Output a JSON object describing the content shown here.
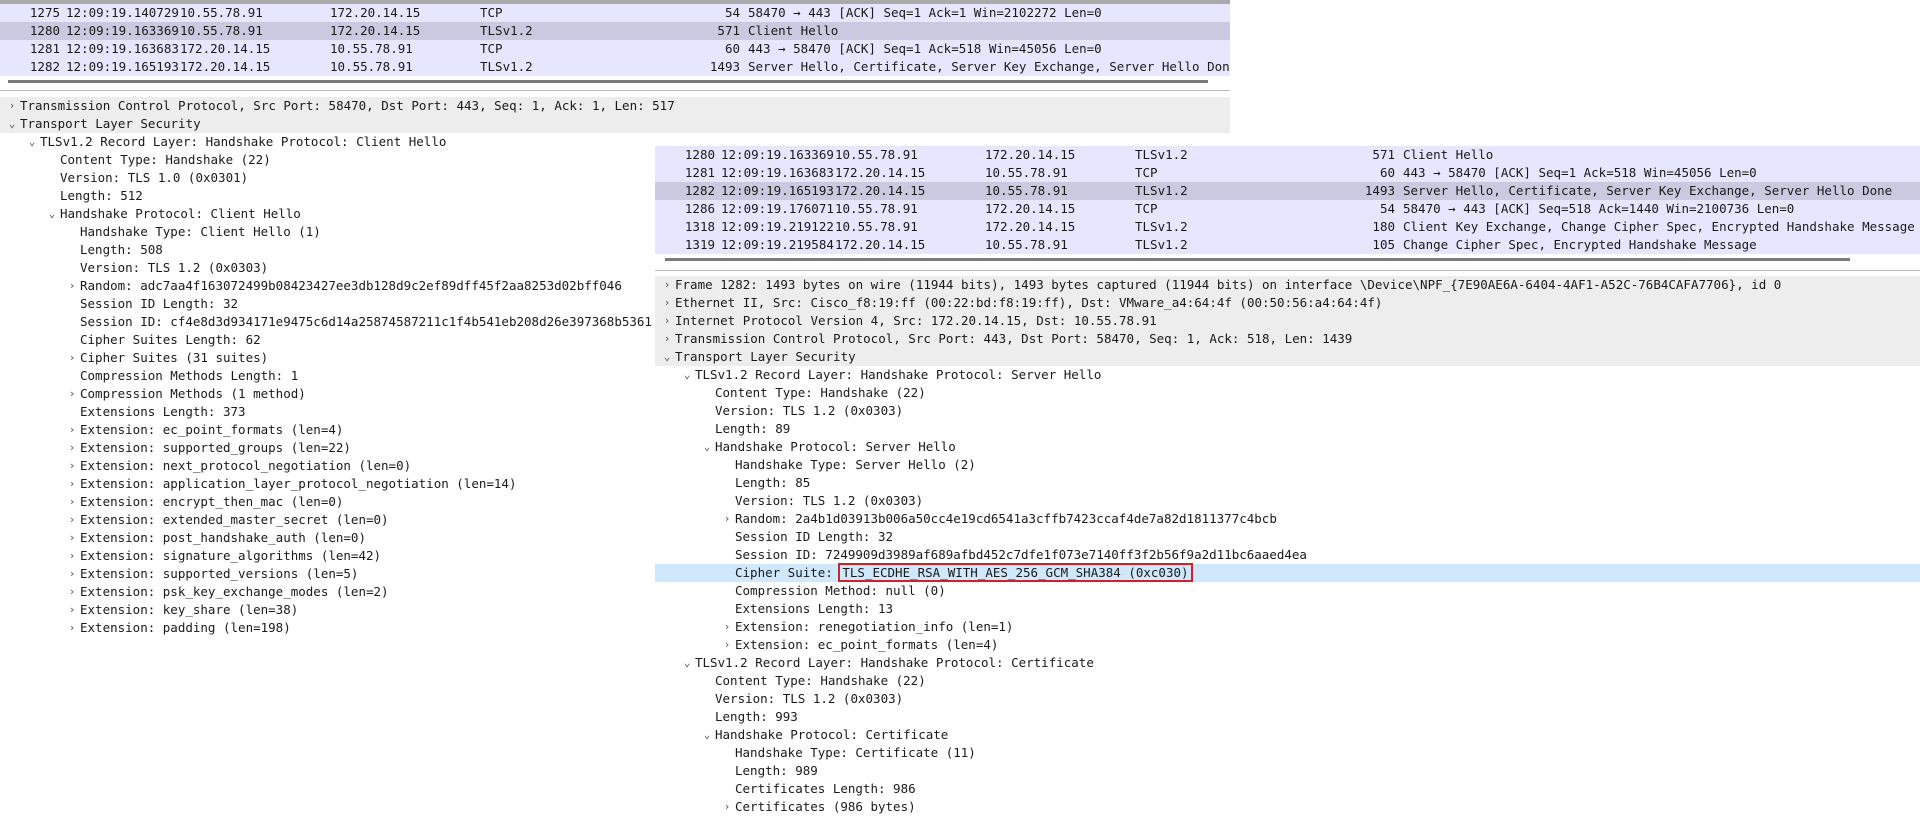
{
  "left_packets": [
    {
      "no": "1275",
      "time": "12:09:19.140729",
      "src": "10.55.78.91",
      "dst": "172.20.14.15",
      "proto": "TCP",
      "len": "54",
      "info": "58470 → 443 [ACK] Seq=1 Ack=1 Win=2102272 Len=0",
      "style": "norm"
    },
    {
      "no": "1280",
      "time": "12:09:19.163369",
      "src": "10.55.78.91",
      "dst": "172.20.14.15",
      "proto": "TLSv1.2",
      "len": "571",
      "info": "Client Hello",
      "style": "selected"
    },
    {
      "no": "1281",
      "time": "12:09:19.163683",
      "src": "172.20.14.15",
      "dst": "10.55.78.91",
      "proto": "TCP",
      "len": "60",
      "info": "443 → 58470 [ACK] Seq=1 Ack=518 Win=45056 Len=0",
      "style": "norm"
    },
    {
      "no": "1282",
      "time": "12:09:19.165193",
      "src": "172.20.14.15",
      "dst": "10.55.78.91",
      "proto": "TLSv1.2",
      "len": "1493",
      "info": "Server Hello, Certificate, Server Key Exchange, Server Hello Done",
      "style": "norm"
    }
  ],
  "left_tree": [
    {
      "indent": 0,
      "toggle": "closed",
      "text": "Transmission Control Protocol, Src Port: 58470, Dst Port: 443, Seq: 1, Ack: 1, Len: 517",
      "shade": true
    },
    {
      "indent": 0,
      "toggle": "open",
      "text": "Transport Layer Security",
      "shade": true
    },
    {
      "indent": 1,
      "toggle": "open",
      "text": "TLSv1.2 Record Layer: Handshake Protocol: Client Hello"
    },
    {
      "indent": 2,
      "toggle": "",
      "text": "Content Type: Handshake (22)"
    },
    {
      "indent": 2,
      "toggle": "",
      "text": "Version: TLS 1.0 (0x0301)"
    },
    {
      "indent": 2,
      "toggle": "",
      "text": "Length: 512"
    },
    {
      "indent": 2,
      "toggle": "open",
      "text": "Handshake Protocol: Client Hello"
    },
    {
      "indent": 3,
      "toggle": "",
      "text": "Handshake Type: Client Hello (1)"
    },
    {
      "indent": 3,
      "toggle": "",
      "text": "Length: 508"
    },
    {
      "indent": 3,
      "toggle": "",
      "text": "Version: TLS 1.2 (0x0303)"
    },
    {
      "indent": 3,
      "toggle": "closed",
      "text": "Random: adc7aa4f163072499b08423427ee3db128d9c2ef89dff45f2aa8253d02bff046"
    },
    {
      "indent": 3,
      "toggle": "",
      "text": "Session ID Length: 32"
    },
    {
      "indent": 3,
      "toggle": "",
      "text": "Session ID: cf4e8d3d934171e9475c6d14a25874587211c1f4b541eb208d26e397368b5361"
    },
    {
      "indent": 3,
      "toggle": "",
      "text": "Cipher Suites Length: 62"
    },
    {
      "indent": 3,
      "toggle": "closed",
      "text": "Cipher Suites (31 suites)"
    },
    {
      "indent": 3,
      "toggle": "",
      "text": "Compression Methods Length: 1"
    },
    {
      "indent": 3,
      "toggle": "closed",
      "text": "Compression Methods (1 method)"
    },
    {
      "indent": 3,
      "toggle": "",
      "text": "Extensions Length: 373"
    },
    {
      "indent": 3,
      "toggle": "closed",
      "text": "Extension: ec_point_formats (len=4)"
    },
    {
      "indent": 3,
      "toggle": "closed",
      "text": "Extension: supported_groups (len=22)"
    },
    {
      "indent": 3,
      "toggle": "closed",
      "text": "Extension: next_protocol_negotiation (len=0)"
    },
    {
      "indent": 3,
      "toggle": "closed",
      "text": "Extension: application_layer_protocol_negotiation (len=14)"
    },
    {
      "indent": 3,
      "toggle": "closed",
      "text": "Extension: encrypt_then_mac (len=0)"
    },
    {
      "indent": 3,
      "toggle": "closed",
      "text": "Extension: extended_master_secret (len=0)"
    },
    {
      "indent": 3,
      "toggle": "closed",
      "text": "Extension: post_handshake_auth (len=0)"
    },
    {
      "indent": 3,
      "toggle": "closed",
      "text": "Extension: signature_algorithms (len=42)"
    },
    {
      "indent": 3,
      "toggle": "closed",
      "text": "Extension: supported_versions (len=5)"
    },
    {
      "indent": 3,
      "toggle": "closed",
      "text": "Extension: psk_key_exchange_modes (len=2)"
    },
    {
      "indent": 3,
      "toggle": "closed",
      "text": "Extension: key_share (len=38)"
    },
    {
      "indent": 3,
      "toggle": "closed",
      "text": "Extension: padding (len=198)"
    }
  ],
  "right_packets": [
    {
      "no": "1280",
      "time": "12:09:19.163369",
      "src": "10.55.78.91",
      "dst": "172.20.14.15",
      "proto": "TLSv1.2",
      "len": "571",
      "info": "Client Hello",
      "style": "norm"
    },
    {
      "no": "1281",
      "time": "12:09:19.163683",
      "src": "172.20.14.15",
      "dst": "10.55.78.91",
      "proto": "TCP",
      "len": "60",
      "info": "443 → 58470 [ACK] Seq=1 Ack=518 Win=45056 Len=0",
      "style": "norm"
    },
    {
      "no": "1282",
      "time": "12:09:19.165193",
      "src": "172.20.14.15",
      "dst": "10.55.78.91",
      "proto": "TLSv1.2",
      "len": "1493",
      "info": "Server Hello, Certificate, Server Key Exchange, Server Hello Done",
      "style": "selected"
    },
    {
      "no": "1286",
      "time": "12:09:19.176071",
      "src": "10.55.78.91",
      "dst": "172.20.14.15",
      "proto": "TCP",
      "len": "54",
      "info": "58470 → 443 [ACK] Seq=518 Ack=1440 Win=2100736 Len=0",
      "style": "norm"
    },
    {
      "no": "1318",
      "time": "12:09:19.219122",
      "src": "10.55.78.91",
      "dst": "172.20.14.15",
      "proto": "TLSv1.2",
      "len": "180",
      "info": "Client Key Exchange, Change Cipher Spec, Encrypted Handshake Message",
      "style": "norm"
    },
    {
      "no": "1319",
      "time": "12:09:19.219584",
      "src": "172.20.14.15",
      "dst": "10.55.78.91",
      "proto": "TLSv1.2",
      "len": "105",
      "info": "Change Cipher Spec, Encrypted Handshake Message",
      "style": "norm"
    }
  ],
  "right_tree": [
    {
      "indent": 0,
      "toggle": "closed",
      "text": "Frame 1282: 1493 bytes on wire (11944 bits), 1493 bytes captured (11944 bits) on interface \\Device\\NPF_{7E90AE6A-6404-4AF1-A52C-76B4CAFA7706}, id 0",
      "shade": true
    },
    {
      "indent": 0,
      "toggle": "closed",
      "text": "Ethernet II, Src: Cisco_f8:19:ff (00:22:bd:f8:19:ff), Dst: VMware_a4:64:4f (00:50:56:a4:64:4f)",
      "shade": true
    },
    {
      "indent": 0,
      "toggle": "closed",
      "text": "Internet Protocol Version 4, Src: 172.20.14.15, Dst: 10.55.78.91",
      "shade": true
    },
    {
      "indent": 0,
      "toggle": "closed",
      "text": "Transmission Control Protocol, Src Port: 443, Dst Port: 58470, Seq: 1, Ack: 518, Len: 1439",
      "shade": true
    },
    {
      "indent": 0,
      "toggle": "open",
      "text": "Transport Layer Security",
      "shade": true
    },
    {
      "indent": 1,
      "toggle": "open",
      "text": "TLSv1.2 Record Layer: Handshake Protocol: Server Hello"
    },
    {
      "indent": 2,
      "toggle": "",
      "text": "Content Type: Handshake (22)"
    },
    {
      "indent": 2,
      "toggle": "",
      "text": "Version: TLS 1.2 (0x0303)"
    },
    {
      "indent": 2,
      "toggle": "",
      "text": "Length: 89"
    },
    {
      "indent": 2,
      "toggle": "open",
      "text": "Handshake Protocol: Server Hello"
    },
    {
      "indent": 3,
      "toggle": "",
      "text": "Handshake Type: Server Hello (2)"
    },
    {
      "indent": 3,
      "toggle": "",
      "text": "Length: 85"
    },
    {
      "indent": 3,
      "toggle": "",
      "text": "Version: TLS 1.2 (0x0303)"
    },
    {
      "indent": 3,
      "toggle": "closed",
      "text": "Random: 2a4b1d03913b006a50cc4e19cd6541a3cffb7423ccaf4de7a82d1811377c4bcb"
    },
    {
      "indent": 3,
      "toggle": "",
      "text": "Session ID Length: 32"
    },
    {
      "indent": 3,
      "toggle": "",
      "text": "Session ID: 7249909d3989af689afbd452c7dfe1f073e7140ff3f2b56f9a2d11bc6aaed4ea"
    },
    {
      "indent": 3,
      "toggle": "",
      "text": "Cipher Suite: ",
      "boxed": "TLS_ECDHE_RSA_WITH_AES_256_GCM_SHA384 (0xc030)",
      "highlight": true
    },
    {
      "indent": 3,
      "toggle": "",
      "text": "Compression Method: null (0)"
    },
    {
      "indent": 3,
      "toggle": "",
      "text": "Extensions Length: 13"
    },
    {
      "indent": 3,
      "toggle": "closed",
      "text": "Extension: renegotiation_info (len=1)"
    },
    {
      "indent": 3,
      "toggle": "closed",
      "text": "Extension: ec_point_formats (len=4)"
    },
    {
      "indent": 1,
      "toggle": "open",
      "text": "TLSv1.2 Record Layer: Handshake Protocol: Certificate"
    },
    {
      "indent": 2,
      "toggle": "",
      "text": "Content Type: Handshake (22)"
    },
    {
      "indent": 2,
      "toggle": "",
      "text": "Version: TLS 1.2 (0x0303)"
    },
    {
      "indent": 2,
      "toggle": "",
      "text": "Length: 993"
    },
    {
      "indent": 2,
      "toggle": "open",
      "text": "Handshake Protocol: Certificate"
    },
    {
      "indent": 3,
      "toggle": "",
      "text": "Handshake Type: Certificate (11)"
    },
    {
      "indent": 3,
      "toggle": "",
      "text": "Length: 989"
    },
    {
      "indent": 3,
      "toggle": "",
      "text": "Certificates Length: 986"
    },
    {
      "indent": 3,
      "toggle": "closed",
      "text": "Certificates (986 bytes)"
    }
  ],
  "colors": {
    "selected_row": "#c9cadf",
    "tls_row": "#e7e6ff",
    "highlight_row": "#cfe8fc",
    "box_outline": "#d0202a"
  },
  "icons": {
    "open": "chevron-down-icon",
    "closed": "chevron-right-icon"
  }
}
